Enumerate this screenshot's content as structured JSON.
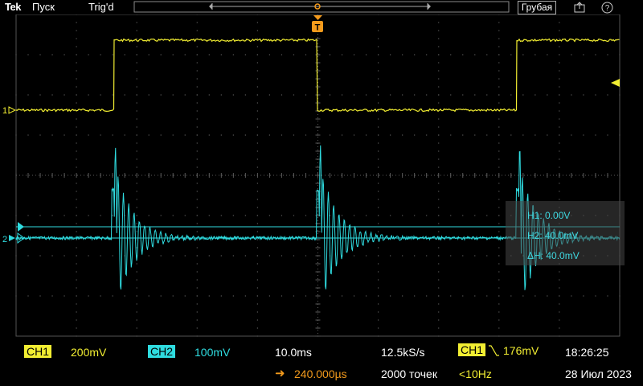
{
  "header": {
    "logo": "Tek",
    "run_state": "Пуск",
    "trigger_status": "Trig'd",
    "acquire_mode": "Грубая"
  },
  "icons": {
    "save": "save-icon",
    "help": "help-icon"
  },
  "colors": {
    "ch1": "#f2ee32",
    "ch2": "#2fdce0",
    "trigger": "#f39a1c",
    "grid": "#5a5a5a"
  },
  "channels": {
    "ch1": {
      "label": "CH1",
      "scale": "200mV",
      "marker": "1"
    },
    "ch2": {
      "label": "CH2",
      "scale": "100mV",
      "marker": "2"
    }
  },
  "timebase": {
    "scale": "10.0ms",
    "delay": "240.000µs",
    "sample_rate": "12.5kS/s",
    "record_length": "2000 точек"
  },
  "trigger": {
    "source": "CH1",
    "level": "176mV",
    "frequency": "<10Hz",
    "marker": "T"
  },
  "datetime": {
    "time": "18:26:25",
    "date": "28 Июл 2023"
  },
  "cursors": {
    "h1": "H1: 0.00V",
    "h2": "H2: 40.0mV",
    "delta": "ΔH: 40.0mV"
  }
}
